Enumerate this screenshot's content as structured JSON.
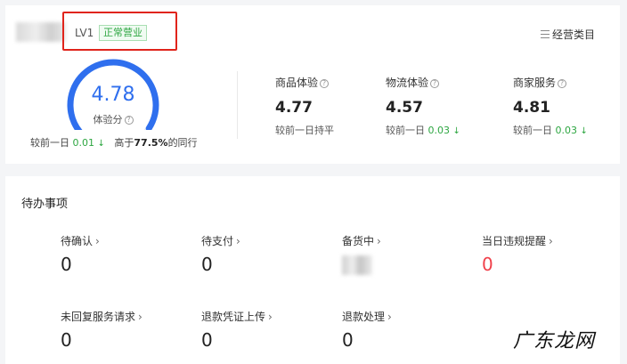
{
  "shop": {
    "level": "LV1",
    "status": "正常营业"
  },
  "header": {
    "category_link": "经营类目",
    "category_icon": "list-icon"
  },
  "experience": {
    "score": "4.78",
    "label": "体验分",
    "compare_prefix": "较前一日",
    "compare_value": "0.01",
    "compare_arrow": "↓",
    "rank_prefix": "高于",
    "rank_value": "77.5%",
    "rank_suffix": "的同行",
    "gauge_fraction": 0.956,
    "gauge_color": "#2f6fee"
  },
  "metrics": [
    {
      "label": "商品体验",
      "value": "4.77",
      "compare": "较前一日持平"
    },
    {
      "label": "物流体验",
      "value": "4.57",
      "compare_prefix": "较前一日",
      "compare_value": "0.03",
      "arrow": "↓"
    },
    {
      "label": "商家服务",
      "value": "4.81",
      "compare_prefix": "较前一日",
      "compare_value": "0.03",
      "arrow": "↓"
    }
  ],
  "todo": {
    "title": "待办事项",
    "items": [
      {
        "label": "待确认",
        "value": "0"
      },
      {
        "label": "待支付",
        "value": "0"
      },
      {
        "label": "备货中"
      },
      {
        "label": "当日违规提醒",
        "value": "0"
      },
      {
        "label": "未回复服务请求",
        "value": "0"
      },
      {
        "label": "退款凭证上传",
        "value": "0"
      },
      {
        "label": "退款处理",
        "value": "0"
      }
    ],
    "chevron": "›"
  },
  "watermark": "广东龙网",
  "colors": {
    "accent": "#2f6fee",
    "green": "#2da641",
    "red": "#f0404a",
    "highlight": "#e0241b"
  }
}
